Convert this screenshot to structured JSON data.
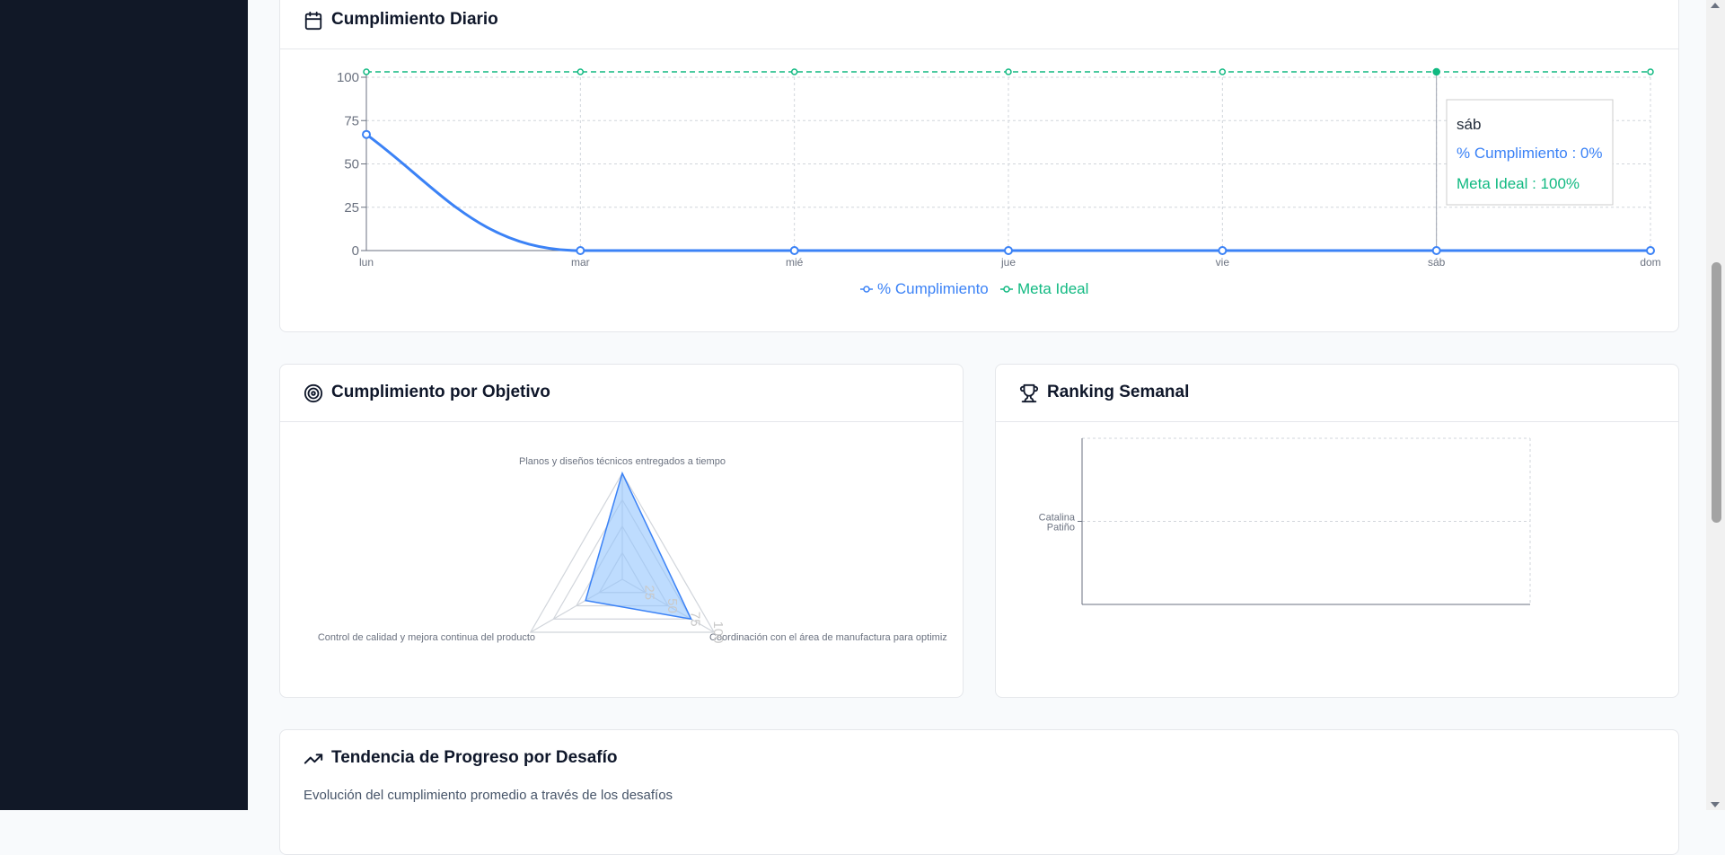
{
  "colors": {
    "sidebar": "#111827",
    "compliance": "#3b82f6",
    "ideal": "#10b981",
    "radar_fill": "#93c5fd"
  },
  "daily": {
    "title": "Cumplimiento Diario",
    "icon": "calendar-icon",
    "tooltip": {
      "title": "sáb",
      "compliance_label": "% Cumplimiento : 0%",
      "ideal_label": "Meta Ideal : 100%"
    },
    "legend": [
      "% Cumplimiento",
      "Meta Ideal"
    ]
  },
  "objective": {
    "title": "Cumplimiento por Objetivo",
    "icon": "target-icon"
  },
  "ranking": {
    "title": "Ranking Semanal",
    "icon": "trophy-icon"
  },
  "trend": {
    "title": "Tendencia de Progreso por Desafío",
    "subtitle": "Evolución del cumplimiento promedio a través de los desafíos",
    "icon": "trending-up-icon"
  },
  "chart_data": [
    {
      "type": "line",
      "categories": [
        "lun",
        "mar",
        "mié",
        "jue",
        "vie",
        "sáb",
        "dom"
      ],
      "series": [
        {
          "name": "% Cumplimiento",
          "values": [
            67,
            0,
            0,
            0,
            0,
            0,
            0
          ]
        },
        {
          "name": "Meta Ideal",
          "values": [
            100,
            100,
            100,
            100,
            100,
            100,
            100
          ]
        }
      ],
      "ylim": [
        0,
        100
      ],
      "yticks": [
        0,
        25,
        50,
        75,
        100
      ],
      "grid": true,
      "legend": "bottom",
      "tooltip_category": "sáb"
    },
    {
      "type": "radar",
      "axes": [
        "Planos y diseños técnicos entregados a tiempo",
        "Coordinación con el área de manufactura para optimiz",
        "Control de calidad y mejora continua del producto"
      ],
      "values": [
        100,
        75,
        40
      ],
      "radial_ticks": [
        "25",
        "50",
        "75",
        "100"
      ],
      "rlim": [
        0,
        100
      ]
    },
    {
      "type": "bar",
      "orientation": "horizontal",
      "categories": [
        "Catalina Patiño"
      ],
      "values": [
        0
      ],
      "grid": true
    }
  ]
}
